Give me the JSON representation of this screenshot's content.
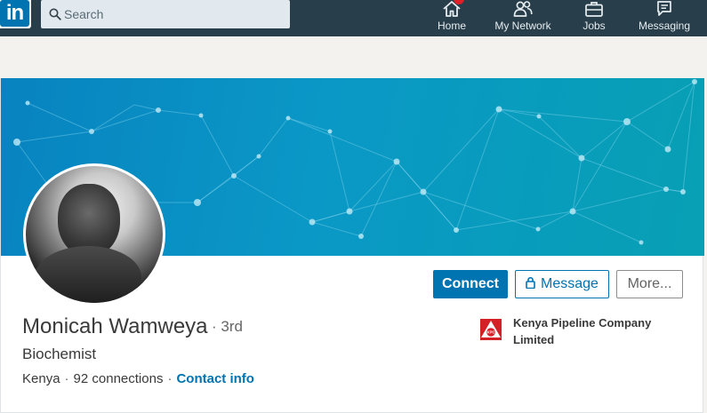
{
  "nav": {
    "logo_text": "in",
    "search_placeholder": "Search",
    "items": [
      {
        "label": "Home",
        "icon": "home-icon",
        "has_badge": true
      },
      {
        "label": "My Network",
        "icon": "network-icon"
      },
      {
        "label": "Jobs",
        "icon": "briefcase-icon"
      },
      {
        "label": "Messaging",
        "icon": "messaging-icon"
      }
    ]
  },
  "profile": {
    "name": "Monicah Wamweya",
    "degree": "· 3rd",
    "headline": "Biochemist",
    "location": "Kenya",
    "connections": "92 connections",
    "contact_link": "Contact info",
    "separator": "·"
  },
  "actions": {
    "connect": "Connect",
    "message": "Message",
    "more": "More..."
  },
  "company": {
    "name": "Kenya Pipeline Company Limited",
    "logo_text": "KPC"
  },
  "colors": {
    "brand": "#0073b1",
    "nav_bg": "#283e4a",
    "badge": "#e11f26"
  }
}
